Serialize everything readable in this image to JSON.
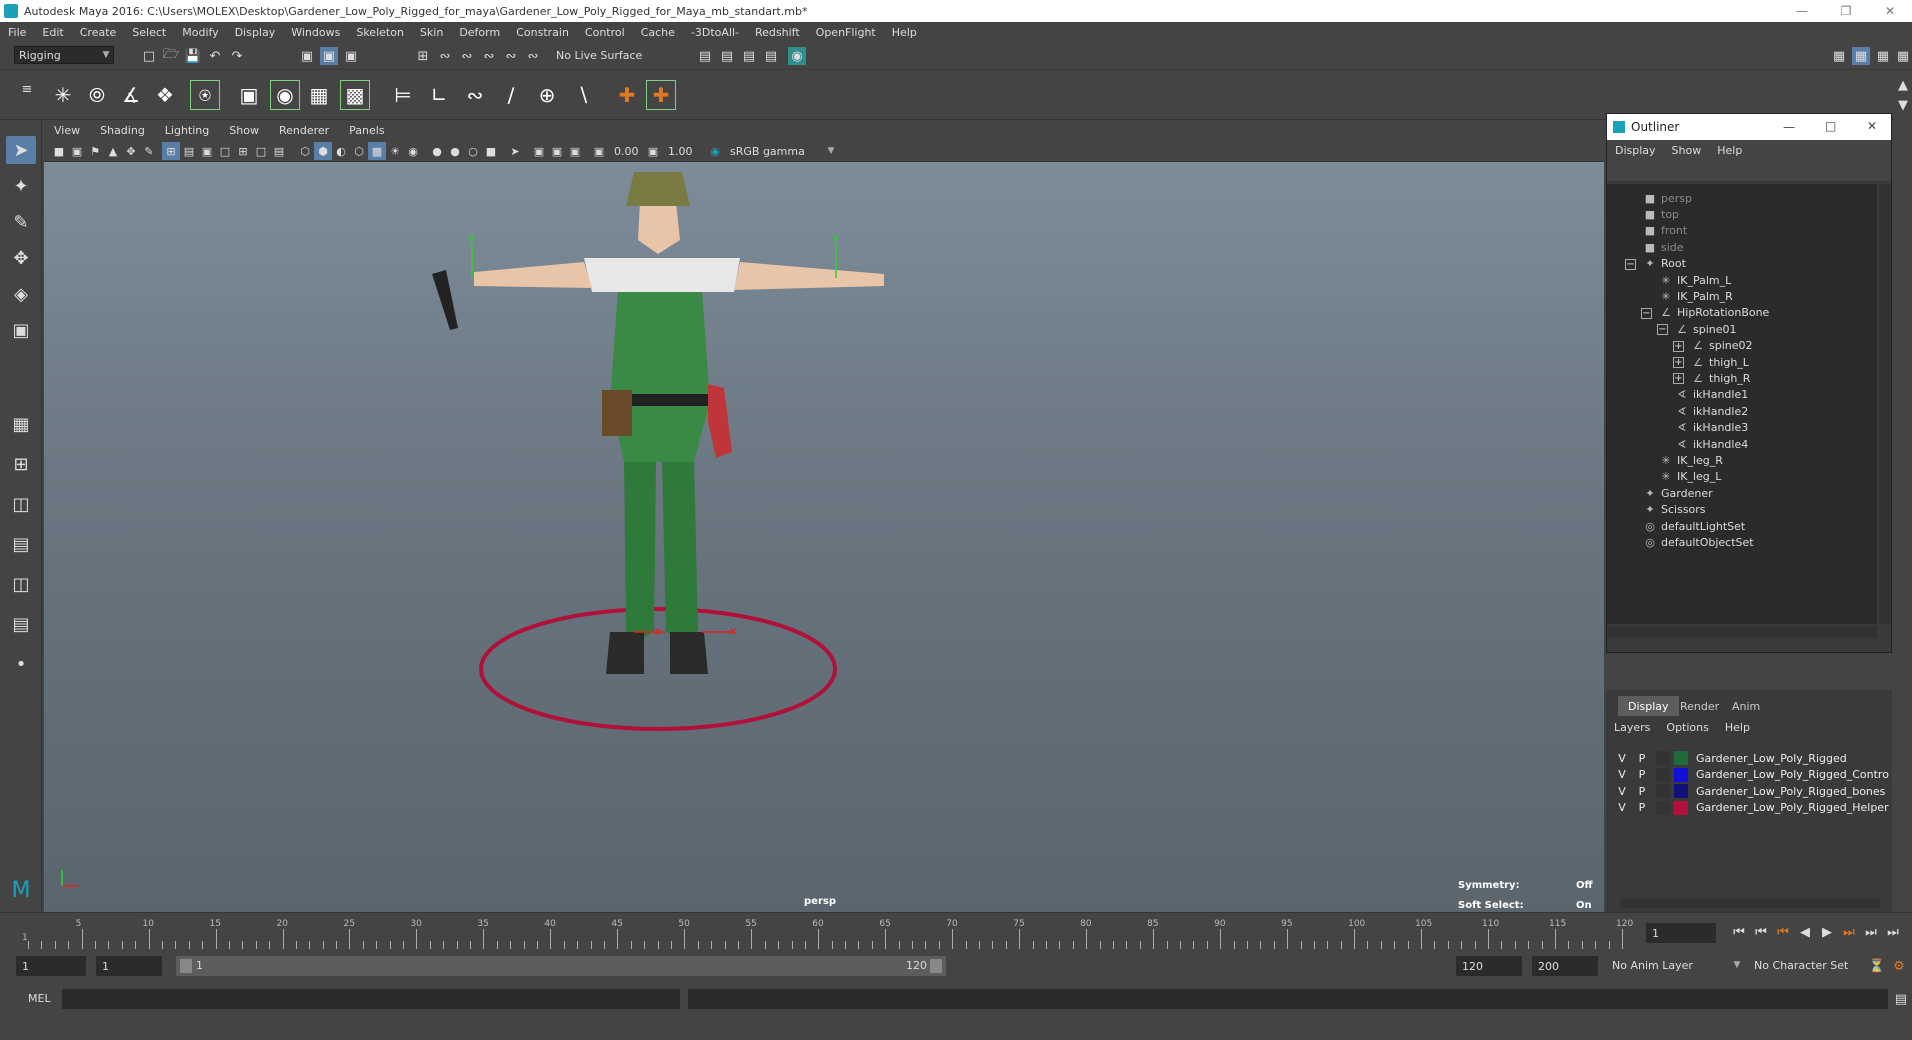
{
  "window": {
    "title": "Autodesk Maya 2016: C:\\Users\\MOLEX\\Desktop\\Gardener_Low_Poly_Rigged_for_maya\\Gardener_Low_Poly_Rigged_for_Maya_mb_standart.mb*"
  },
  "menubar": [
    "File",
    "Edit",
    "Create",
    "Select",
    "Modify",
    "Display",
    "Windows",
    "Skeleton",
    "Skin",
    "Deform",
    "Constrain",
    "Control",
    "Cache",
    "-3DtoAll-",
    "Redshift",
    "OpenFlight",
    "Help"
  ],
  "toolbar": {
    "menuset": "Rigging",
    "live_surface": "No Live Surface"
  },
  "panel": {
    "menus": [
      "View",
      "Shading",
      "Lighting",
      "Show",
      "Renderer",
      "Panels"
    ],
    "exposure": "0.00",
    "gamma": "1.00",
    "colorspace": "sRGB gamma"
  },
  "viewport": {
    "camera": "persp",
    "symmetry_label": "Symmetry:",
    "symmetry_value": "Off",
    "soft_select_label": "Soft Select:",
    "soft_select_value": "On",
    "axis_y": "y",
    "axis_x": "x"
  },
  "outliner": {
    "title": "Outliner",
    "menus": [
      "Display",
      "Show",
      "Help"
    ],
    "items": [
      {
        "label": "persp",
        "level": 0,
        "icon": "camera-icon",
        "dim": true
      },
      {
        "label": "top",
        "level": 0,
        "icon": "camera-icon",
        "dim": true
      },
      {
        "label": "front",
        "level": 0,
        "icon": "camera-icon",
        "dim": true
      },
      {
        "label": "side",
        "level": 0,
        "icon": "camera-icon",
        "dim": true
      },
      {
        "label": "Root",
        "level": 0,
        "icon": "group-icon",
        "dim": false
      },
      {
        "label": "IK_Palm_L",
        "level": 1,
        "icon": "ik-icon",
        "dim": false
      },
      {
        "label": "IK_Palm_R",
        "level": 1,
        "icon": "ik-icon",
        "dim": false
      },
      {
        "label": "HipRotationBone",
        "level": 1,
        "icon": "joint-icon",
        "dim": false
      },
      {
        "label": "spine01",
        "level": 2,
        "icon": "joint-icon",
        "dim": false
      },
      {
        "label": "spine02",
        "level": 3,
        "icon": "joint-icon",
        "dim": false
      },
      {
        "label": "thigh_L",
        "level": 3,
        "icon": "joint-icon",
        "dim": false
      },
      {
        "label": "thigh_R",
        "level": 3,
        "icon": "joint-icon",
        "dim": false
      },
      {
        "label": "ikHandle1",
        "level": 2,
        "icon": "ikhandle-icon",
        "dim": false
      },
      {
        "label": "ikHandle2",
        "level": 2,
        "icon": "ikhandle-icon",
        "dim": false
      },
      {
        "label": "ikHandle3",
        "level": 2,
        "icon": "ikhandle-icon",
        "dim": false
      },
      {
        "label": "ikHandle4",
        "level": 2,
        "icon": "ikhandle-icon",
        "dim": false
      },
      {
        "label": "IK_leg_R",
        "level": 1,
        "icon": "ik-icon",
        "dim": false
      },
      {
        "label": "IK_leg_L",
        "level": 1,
        "icon": "ik-icon",
        "dim": false
      },
      {
        "label": "Gardener",
        "level": 0,
        "icon": "group-icon",
        "dim": false
      },
      {
        "label": "Scissors",
        "level": 0,
        "icon": "group-icon",
        "dim": false
      },
      {
        "label": "defaultLightSet",
        "level": 0,
        "icon": "set-icon",
        "dim": false
      },
      {
        "label": "defaultObjectSet",
        "level": 0,
        "icon": "set-icon",
        "dim": false
      }
    ]
  },
  "layers": {
    "tabs": [
      "Display",
      "Render",
      "Anim"
    ],
    "menus": [
      "Layers",
      "Options",
      "Help"
    ],
    "v": "V",
    "p": "P",
    "rows": [
      {
        "name": "Gardener_Low_Poly_Rigged",
        "color": "#1f6b3a"
      },
      {
        "name": "Gardener_Low_Poly_Rigged_Contro",
        "color": "#1010d8"
      },
      {
        "name": "Gardener_Low_Poly_Rigged_bones",
        "color": "#10107a"
      },
      {
        "name": "Gardener_Low_Poly_Rigged_Helper",
        "color": "#b0103a"
      }
    ]
  },
  "timeline": {
    "ticks": [
      "5",
      "10",
      "15",
      "20",
      "25",
      "30",
      "35",
      "40",
      "45",
      "50",
      "55",
      "60",
      "65",
      "70",
      "75",
      "80",
      "85",
      "90",
      "95",
      "100",
      "105",
      "110",
      "115",
      "120"
    ],
    "first": "1",
    "current_frame": "1"
  },
  "range": {
    "start": "1",
    "start2": "1",
    "slider_start": "1",
    "slider_end": "120",
    "end": "120",
    "max": "200",
    "anim_layer": "No Anim Layer",
    "char_set": "No Character Set"
  },
  "cmd": {
    "lang": "MEL"
  },
  "colors": {
    "accent": "#5a7fa6",
    "ground_circle": "#b0103a"
  }
}
